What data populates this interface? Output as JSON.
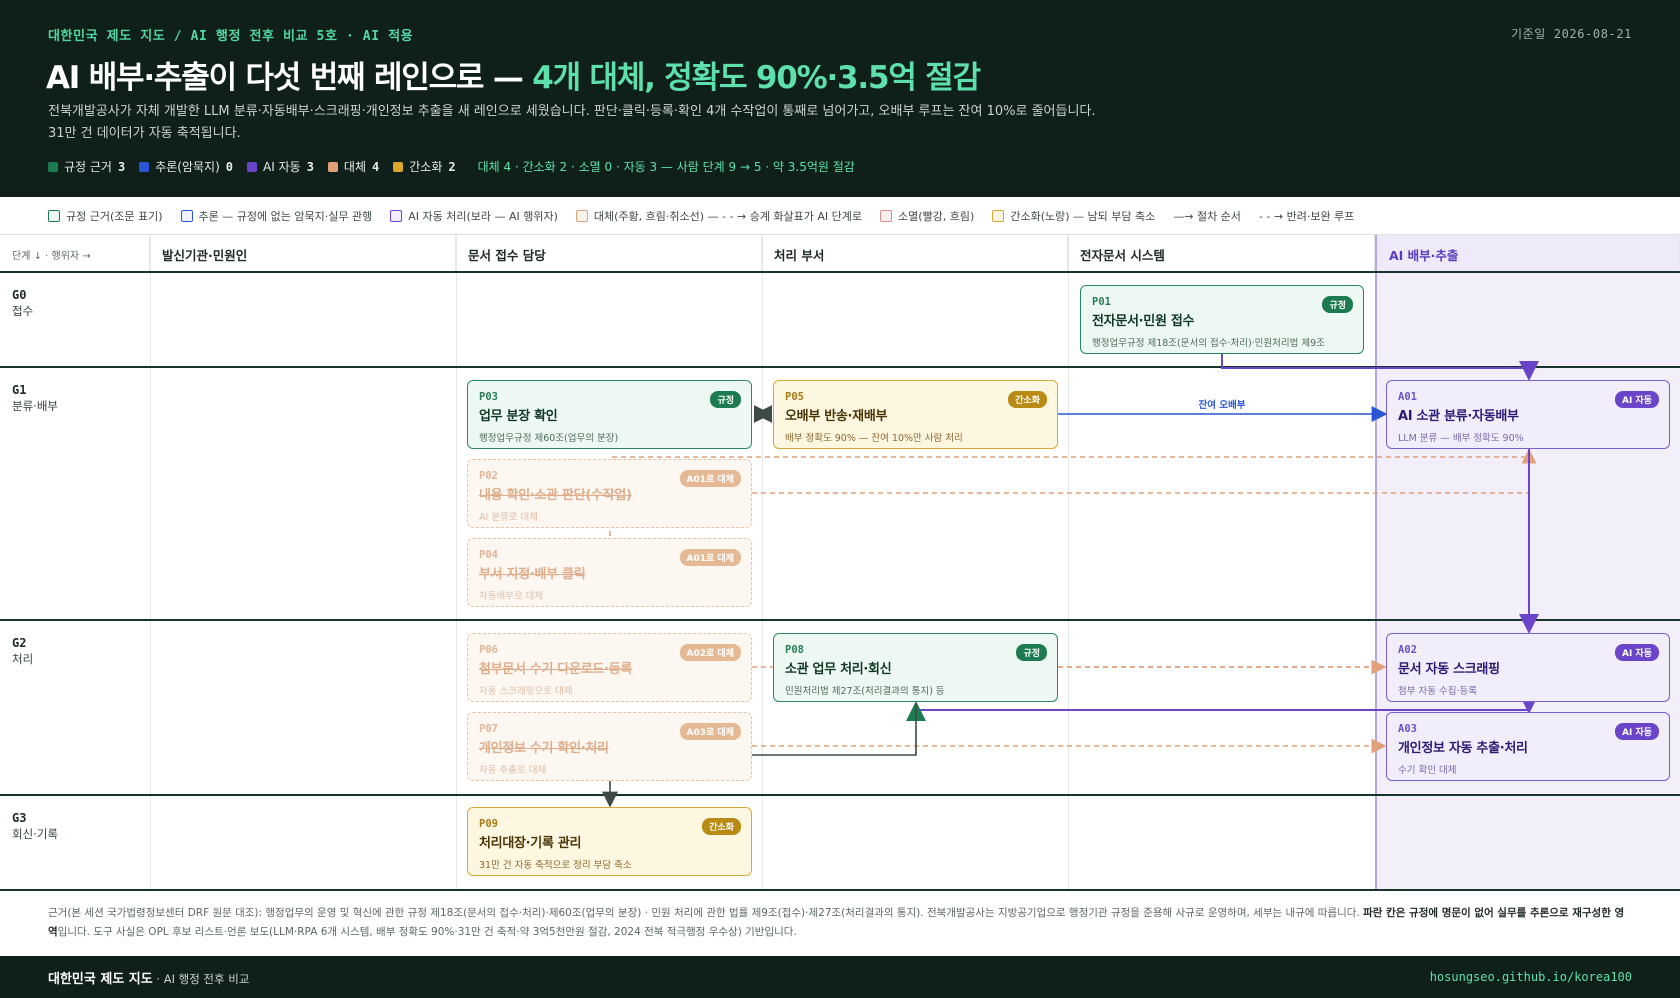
{
  "header": {
    "kicker": "대한민국 제도 지도 / AI 행정 전후 비교 5호 · AI 적용",
    "date": "기준일 2026-08-21",
    "title_main": "AI 배부·추출이 다섯 번째 레인으로 — ",
    "title_accent": "4개 대체, 정확도 90%·3.5억 절감",
    "desc_line1": "전북개발공사가 자체 개발한 LLM 분류·자동배부·스크래핑·개인정보 추출을 새 레인으로 세웠습니다. 판단·클릭·등록·확인 4개 수작업이 통째로 넘어가고, 오배부 루프는 잔여 10%로 줄어듭니다.",
    "desc_line2": "31만 건 데이터가 자동 축적됩니다.",
    "stats": [
      {
        "label": "규정 근거",
        "count": "3",
        "color": "#1d7b52"
      },
      {
        "label": "추론(암묵지)",
        "count": "0",
        "color": "#2a55d6"
      },
      {
        "label": "AI 자동",
        "count": "3",
        "color": "#6a45c9"
      },
      {
        "label": "대체",
        "count": "4",
        "color": "#e0a07a"
      },
      {
        "label": "간소화",
        "count": "2",
        "color": "#d9a82a"
      }
    ],
    "summary": "대체 4 · 간소화 2 · 소멸 0 · 자동 3 — 사람 단계 9 → 5 · 약 3.5억원 절감"
  },
  "legend": {
    "items": [
      {
        "label": "규정 근거(조문 표기)",
        "border": "#1d7b52",
        "fill": "#eef8f2"
      },
      {
        "label": "추론 — 규정에 없는 암묵지·실무 관행",
        "border": "#2a55d6",
        "fill": "#eef2fd"
      },
      {
        "label": "AI 자동 처리(보라 — AI 행위자)",
        "border": "#6a45c9",
        "fill": "#f1edfb"
      },
      {
        "label": "대체(주황, 흐림·취소선) — - - → 승계 화살표가 AI 단계로",
        "border": "#e0a07a",
        "fill": "#fdf3ea"
      },
      {
        "label": "소멸(빨강, 흐림)",
        "border": "#e08a8a",
        "fill": "#fdf0f0"
      },
      {
        "label": "간소화(노랑) — 남되 부담 축소",
        "border": "#d9a82a",
        "fill": "#fdf6e1"
      }
    ],
    "arrow_solid": "—→ 절차 순서",
    "arrow_dashed": "- - → 반려·보완 루프"
  },
  "columns": {
    "stage": "단계 ↓ · 행위자 →",
    "lanes": [
      "발신기관·민원인",
      "문서 접수 담당",
      "처리 부서",
      "전자문서 시스템",
      "AI 배부·추출"
    ]
  },
  "rows": [
    {
      "code": "G0",
      "name": "접수"
    },
    {
      "code": "G1",
      "name": "분류·배부"
    },
    {
      "code": "G2",
      "name": "처리"
    },
    {
      "code": "G3",
      "name": "회신·기록"
    }
  ],
  "nodes": {
    "p01": {
      "id": "P01",
      "title": "전자문서·민원 접수",
      "sub": "행정업무규정 제18조(문서의 접수·처리)·민원처리법 제9조",
      "badge": "규정"
    },
    "p03": {
      "id": "P03",
      "title": "업무 분장 확인",
      "sub": "행정업무규정 제60조(업무의 분장)",
      "badge": "규정"
    },
    "p05": {
      "id": "P05",
      "title": "오배부 반송·재배부",
      "sub": "배부 정확도 90% — 잔여 10%만 사람 처리",
      "badge": "간소화"
    },
    "a01": {
      "id": "A01",
      "title": "AI 소관 분류·자동배부",
      "sub": "LLM 분류 — 배부 정확도 90%",
      "badge": "AI 자동"
    },
    "p02": {
      "id": "P02",
      "title": "내용 확인·소관 판단(수작업)",
      "sub": "AI 분류로 대체",
      "badge": "A01로 대체"
    },
    "p04": {
      "id": "P04",
      "title": "부서 지정·배부 클릭",
      "sub": "자동배부로 대체",
      "badge": "A01로 대체"
    },
    "p06": {
      "id": "P06",
      "title": "첨부문서 수기 다운로드·등록",
      "sub": "자동 스크래핑으로 대체",
      "badge": "A02로 대체"
    },
    "p08": {
      "id": "P08",
      "title": "소관 업무 처리·회신",
      "sub": "민원처리법 제27조(처리결과의 통지) 등",
      "badge": "규정"
    },
    "a02": {
      "id": "A02",
      "title": "문서 자동 스크래핑",
      "sub": "첨부 자동 수집·등록",
      "badge": "AI 자동"
    },
    "p07": {
      "id": "P07",
      "title": "개인정보 수기 확인·처리",
      "sub": "자동 추출로 대체",
      "badge": "A03로 대체"
    },
    "a03": {
      "id": "A03",
      "title": "개인정보 자동 추출·처리",
      "sub": "수기 확인 대체",
      "badge": "AI 자동"
    },
    "p09": {
      "id": "P09",
      "title": "처리대장·기록 관리",
      "sub": "31만 건 자동 축적으로 정리 부담 축소",
      "badge": "간소화"
    }
  },
  "edge_labels": {
    "residual": "잔여 오배부"
  },
  "footnote": {
    "text": "근거(본 세션 국가법령정보센터 DRF 원문 대조): 행정업무의 운영 및 혁신에 관한 규정 제18조(문서의 접수·처리)·제60조(업무의 분장) · 민원 처리에 관한 법률 제9조(접수)·제27조(처리결과의 통지). 전북개발공사는 지방공기업으로 행정기관 규정을 준용해 사규로 운영하며, 세부는 내규에 따릅니다. ",
    "bold": "파란 칸은 규정에 명문이 없어 실무를 추론으로 재구성한 영역",
    "tail": "입니다. 도구 사실은 OPL 후보 리스트·언론 보도(LLM·RPA 6개 시스템, 배부 정확도 90%·31만 건 축적·약 3억5천만원 절감, 2024 전북 적극행정 우수상) 기반입니다."
  },
  "footer": {
    "brand": "대한민국 제도 지도",
    "brand_sub": " · AI 행정 전후 비교",
    "url": "hosungseo.github.io/korea100"
  }
}
